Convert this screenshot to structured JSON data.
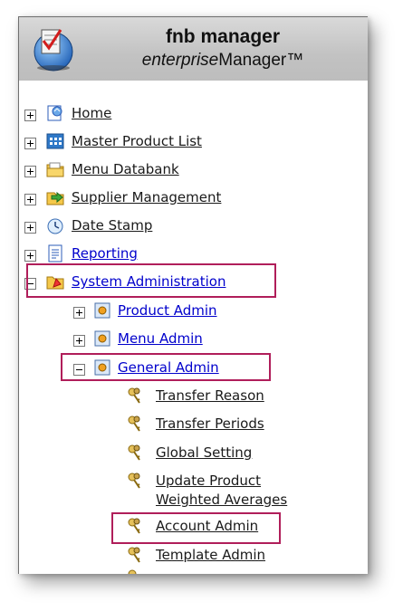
{
  "app": {
    "title": "fnb manager",
    "subtitle_italic": "enterprise",
    "subtitle_rest": "Manager™"
  },
  "tree": {
    "top": [
      {
        "label": "Home",
        "icon": "home-page-icon"
      },
      {
        "label": "Master Product List",
        "icon": "grid-list-icon"
      },
      {
        "label": "Menu Databank",
        "icon": "folder-icon"
      },
      {
        "label": "Supplier Management",
        "icon": "truck-arrow-icon"
      },
      {
        "label": "Date Stamp",
        "icon": "clock-icon"
      },
      {
        "label": "Reporting",
        "icon": "report-document-icon"
      },
      {
        "label": "System Administration",
        "icon": "admin-folder-icon"
      }
    ],
    "sub": [
      {
        "label": "Product Admin",
        "icon": "admin-module-icon"
      },
      {
        "label": "Menu Admin",
        "icon": "admin-module-icon"
      },
      {
        "label": "General Admin",
        "icon": "admin-module-icon"
      }
    ],
    "leaves": [
      {
        "label": "Transfer Reason"
      },
      {
        "label": "Transfer Periods"
      },
      {
        "label": "Global Setting"
      },
      {
        "label": "Update Product",
        "label2": "Weighted Averages"
      },
      {
        "label": "Account Admin"
      },
      {
        "label": "Template Admin"
      }
    ]
  },
  "colors": {
    "highlight": "#b01e5a",
    "link": "#0000cc"
  }
}
